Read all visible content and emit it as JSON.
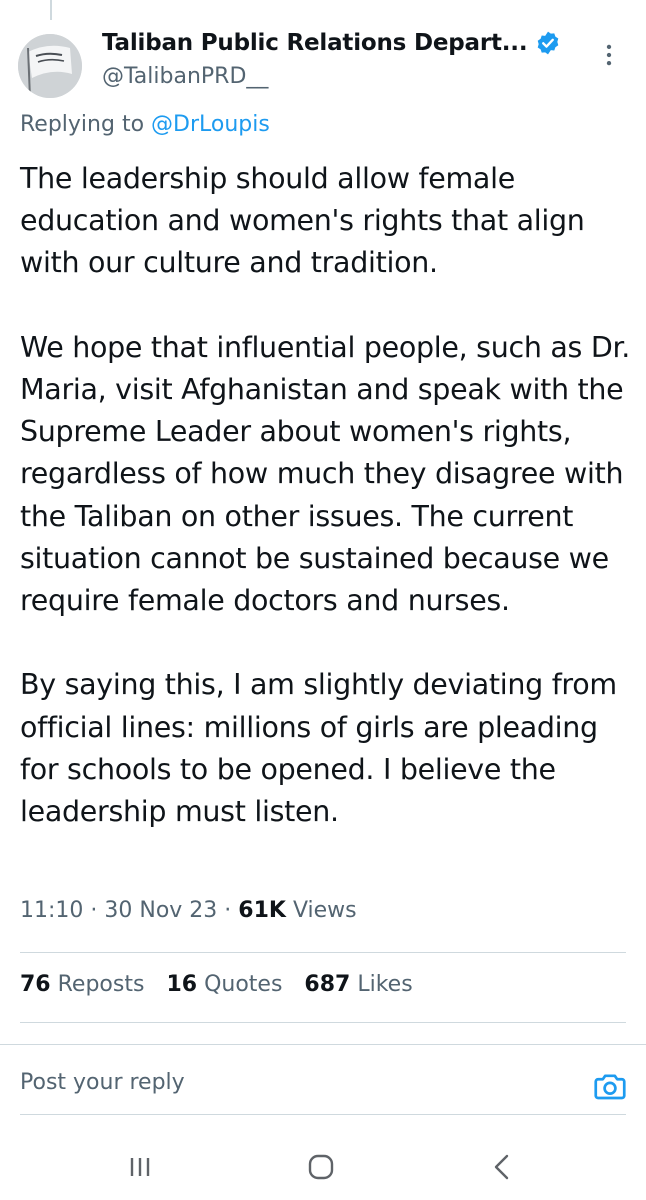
{
  "author": {
    "display_name": "Taliban Public Relations Depart...",
    "handle": "@TalibanPRD__",
    "verified_icon": "verified-badge-icon"
  },
  "reply_context": {
    "prefix": "Replying to ",
    "mention": "@DrLoupis"
  },
  "tweet": {
    "paragraphs": [
      "The leadership should allow female education and women's rights that align with our culture and tradition.",
      "We hope that influential people, such as Dr. Maria, visit Afghanistan and speak with the Supreme Leader about women's rights, regardless of how much they disagree with the Taliban on other issues. The current situation cannot be sustained because we require female doctors and nurses.",
      "By saying this, I am slightly deviating from official lines: millions of girls are pleading for schools to be opened. I believe the leadership must listen."
    ]
  },
  "meta": {
    "time": "11:10",
    "separator": " · ",
    "date": "30 Nov 23",
    "views_count": "61K",
    "views_label": " Views"
  },
  "stats": {
    "reposts_count": "76",
    "reposts_label": "Reposts",
    "quotes_count": "16",
    "quotes_label": "Quotes",
    "likes_count": "687",
    "likes_label": "Likes"
  },
  "reply": {
    "placeholder": "Post your reply"
  },
  "icons": {
    "more": "more-vertical-icon",
    "camera": "camera-icon",
    "nav_recents": "recents-icon",
    "nav_home": "home-icon",
    "nav_back": "back-icon"
  },
  "colors": {
    "accent": "#1d9bf0",
    "text_primary": "#0f1419",
    "text_secondary": "#536471",
    "divider": "#cfd9de"
  }
}
